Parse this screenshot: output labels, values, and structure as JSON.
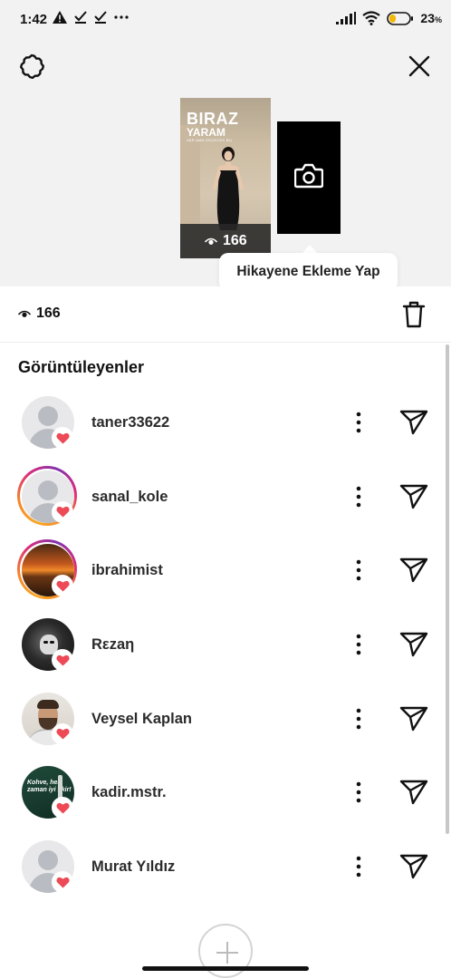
{
  "status_bar": {
    "time": "1:42",
    "battery_percent": "23",
    "battery_unit": "%",
    "battery_level": 0.23
  },
  "header": {
    "settings_icon": "gear-icon",
    "close_icon": "close-icon"
  },
  "story": {
    "title": "BIRAZ",
    "subtitle": "YARAM",
    "small_text": "VAR AMA GEÇECEK BU",
    "views": "166",
    "camera_icon": "camera-icon"
  },
  "tooltip": {
    "text": "Hikayene Ekleme Yap"
  },
  "views_row": {
    "count": "166",
    "delete_icon": "trash-icon"
  },
  "viewers": {
    "section_title": "Görüntüleyenler",
    "items": [
      {
        "username": "taner33622",
        "avatar": "default",
        "ring": false,
        "liked": true
      },
      {
        "username": "sanal_kole",
        "avatar": "default",
        "ring": true,
        "liked": true
      },
      {
        "username": "ibrahimist",
        "avatar": "sunset",
        "ring": true,
        "liked": true
      },
      {
        "username": "Rεzaη",
        "avatar": "dark",
        "ring": false,
        "liked": true
      },
      {
        "username": "Veysel Kaplan",
        "avatar": "man",
        "ring": false,
        "liked": true
      },
      {
        "username": "kadir.mstr.",
        "avatar": "green",
        "avatar_text": "Kohve, her zaman iyi fikir!",
        "ring": false,
        "liked": true
      },
      {
        "username": "Murat Yıldız",
        "avatar": "default",
        "ring": false,
        "liked": true
      }
    ]
  },
  "colors": {
    "heart": "#ed4956",
    "header_bg": "#f2f2f2",
    "text_primary": "#111111"
  }
}
